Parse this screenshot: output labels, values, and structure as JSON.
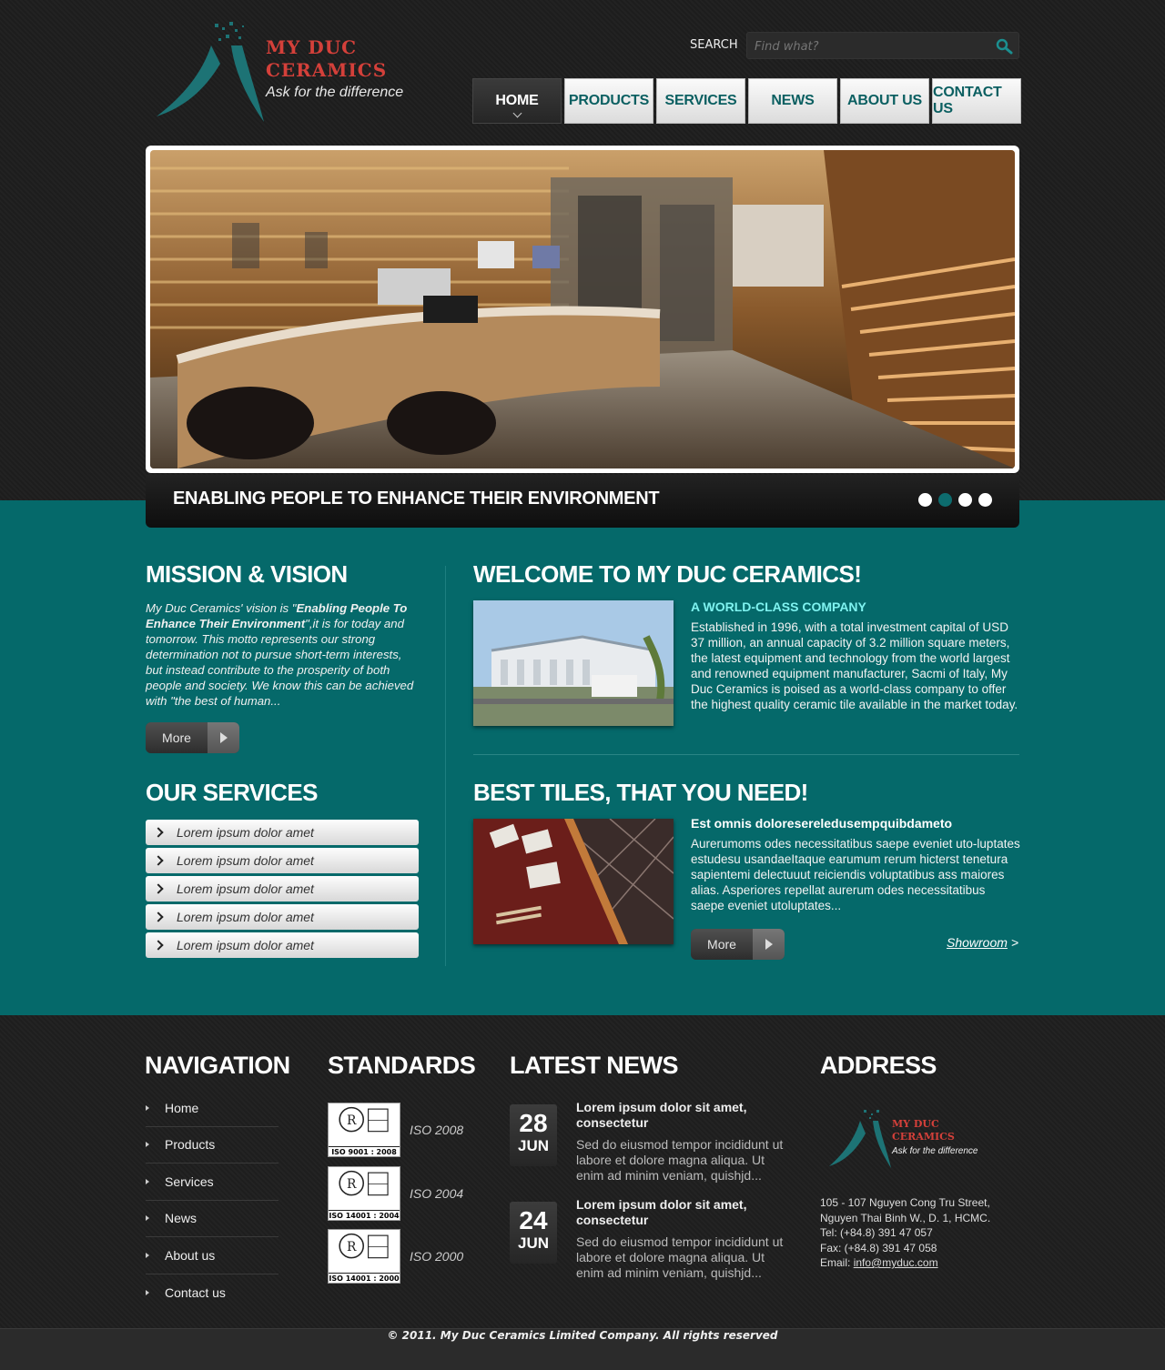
{
  "brand": {
    "line1": "MY DUC",
    "line2": "CERAMICS",
    "tagline": "Ask for the difference"
  },
  "search": {
    "label": "SEARCH",
    "placeholder": "Find what?"
  },
  "nav": {
    "items": [
      {
        "label": "HOME",
        "active": true
      },
      {
        "label": "PRODUCTS"
      },
      {
        "label": "SERVICES"
      },
      {
        "label": "NEWS"
      },
      {
        "label": "ABOUT US"
      },
      {
        "label": "CONTACT US"
      }
    ]
  },
  "slider": {
    "caption": "ENABLING PEOPLE TO ENHANCE THEIR ENVIRONMENT",
    "dots": 4,
    "active_dot": 2
  },
  "mission": {
    "title": "MISSION & VISION",
    "text_pre": "My Duc Ceramics' vision is \"",
    "text_bold": "Enabling People To Enhance Their Environment",
    "text_post": "\",it is for today and tomorrow. This motto represents our strong determination not to pursue short-term interests, but instead contribute to the prosperity of both people and society. We know this can be achieved with \"the best of human...",
    "more": "More"
  },
  "services": {
    "title": "OUR SERVICES",
    "items": [
      "Lorem ipsum dolor amet",
      "Lorem ipsum dolor amet",
      "Lorem ipsum dolor amet",
      "Lorem ipsum dolor amet",
      "Lorem ipsum dolor amet"
    ]
  },
  "welcome": {
    "title": "WELCOME TO MY DUC CERAMICS!",
    "subtitle": "A WORLD-CLASS COMPANY",
    "text": "Established in 1996, with a total investment capital of USD 37 million, an annual capacity of 3.2 million square meters, the latest equipment and technology from the world largest and renowned equipment manufacturer, Sacmi of Italy, My Duc Ceramics is poised as a world-class company to offer the highest quality ceramic tile available in the market today."
  },
  "tiles": {
    "title": "BEST TILES, THAT YOU NEED!",
    "subtitle": "Est omnis doloresereledusempquibdameto",
    "text": "Aurerumoms odes necessitatibus saepe eveniet uto-luptates estudesu usandaeItaque earumum rerum hicterst tenetura sapientemi delectuuut reiciendis voluptatibus ass maiores alias. Asperiores repellat aurerum odes necessitatibus saepe eveniet utoluptates...",
    "more": "More",
    "showroom": "Showroom",
    "showroom_arrow": ">"
  },
  "footer": {
    "navigation": {
      "title": "NAVIGATION",
      "items": [
        "Home",
        "Products",
        "Services",
        "News",
        "About us",
        "Contact us"
      ]
    },
    "standards": {
      "title": "STANDARDS",
      "items": [
        {
          "cert": "ISO 9001 : 2008",
          "label": "ISO 2008"
        },
        {
          "cert": "ISO 14001 : 2004",
          "label": "ISO 2004"
        },
        {
          "cert": "ISO 14001 : 2000",
          "label": "ISO 2000"
        }
      ]
    },
    "news": {
      "title": "LATEST NEWS",
      "items": [
        {
          "day": "28",
          "month": "JUN",
          "title": "Lorem ipsum dolor sit amet, consectetur",
          "text": "Sed do eiusmod tempor incididunt ut labore et dolore magna aliqua. Ut enim ad minim veniam, quishjd..."
        },
        {
          "day": "24",
          "month": "JUN",
          "title": "Lorem ipsum dolor sit amet, consectetur",
          "text": "Sed do eiusmod tempor incididunt ut labore et dolore magna aliqua. Ut enim ad minim veniam, quishjd..."
        }
      ]
    },
    "address": {
      "title": "ADDRESS",
      "line1": "105 - 107 Nguyen Cong Tru Street,",
      "line2": "Nguyen Thai Binh W., D. 1, HCMC.",
      "tel": "Tel: (+84.8) 391 47 057",
      "fax": "Fax: (+84.8) 391 47 058",
      "email_label": "Email: ",
      "email": "info@myduc.com"
    }
  },
  "copyright": "© 2011. My Duc Ceramics Limited Company. All rights reserved",
  "colors": {
    "teal": "#05696a",
    "brand_red": "#d4403a",
    "nav_text": "#0b5f61",
    "highlight": "#7ff3f0"
  }
}
